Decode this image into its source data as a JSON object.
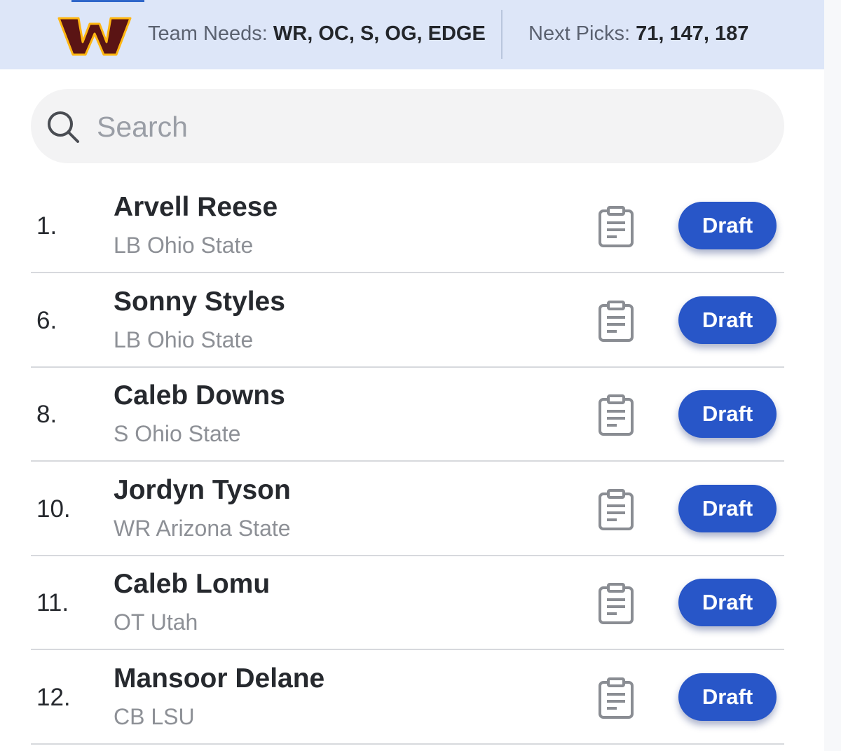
{
  "header": {
    "team_needs_label": "Team Needs:",
    "team_needs_value": "WR, OC, S, OG, EDGE",
    "next_picks_label": "Next Picks:",
    "next_picks_value": "71, 147, 187",
    "logo_icon": "commanders-w-logo",
    "colors": {
      "background": "#dde6f8",
      "logo_burgundy": "#5a1414",
      "logo_gold": "#ffb612"
    }
  },
  "search": {
    "placeholder": "Search",
    "value": "",
    "icon": "search-icon"
  },
  "players": [
    {
      "rank": "1.",
      "name": "Arvell Reese",
      "details": "LB Ohio State",
      "action": "Draft"
    },
    {
      "rank": "6.",
      "name": "Sonny Styles",
      "details": "LB Ohio State",
      "action": "Draft"
    },
    {
      "rank": "8.",
      "name": "Caleb Downs",
      "details": "S Ohio State",
      "action": "Draft"
    },
    {
      "rank": "10.",
      "name": "Jordyn Tyson",
      "details": "WR Arizona State",
      "action": "Draft"
    },
    {
      "rank": "11.",
      "name": "Caleb Lomu",
      "details": "OT Utah",
      "action": "Draft"
    },
    {
      "rank": "12.",
      "name": "Mansoor Delane",
      "details": "CB LSU",
      "action": "Draft"
    }
  ],
  "row_icon": "clipboard-icon",
  "accent_color": "#2856c8"
}
